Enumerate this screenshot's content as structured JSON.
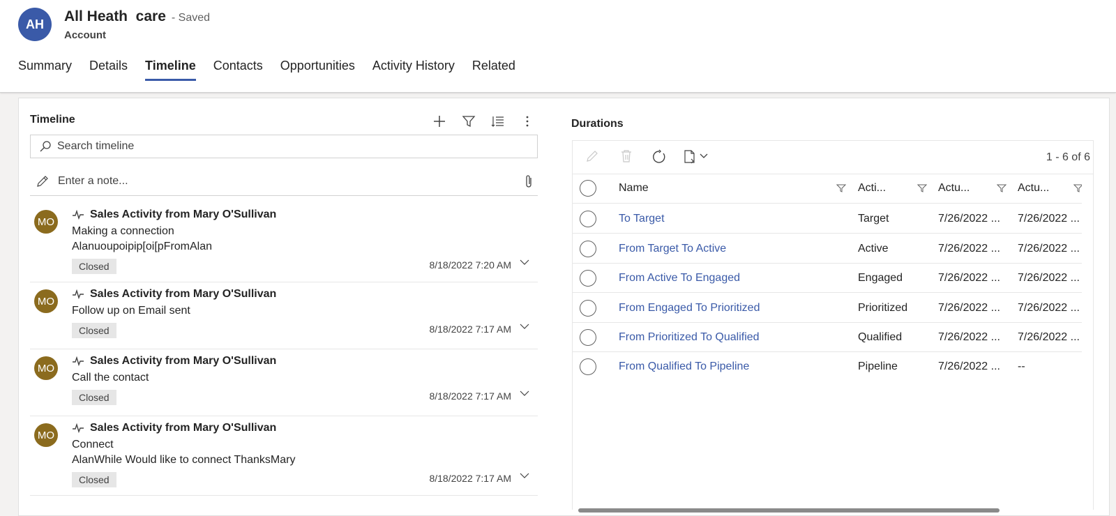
{
  "header": {
    "avatar_initials": "AH",
    "title": "All Heath  care",
    "saved_status": "- Saved",
    "record_type": "Account"
  },
  "tabs": [
    {
      "label": "Summary",
      "active": false
    },
    {
      "label": "Details",
      "active": false
    },
    {
      "label": "Timeline",
      "active": true
    },
    {
      "label": "Contacts",
      "active": false
    },
    {
      "label": "Opportunities",
      "active": false
    },
    {
      "label": "Activity History",
      "active": false
    },
    {
      "label": "Related",
      "active": false
    }
  ],
  "timeline": {
    "title": "Timeline",
    "actions": [
      "add-icon",
      "filter-icon",
      "sort-icon",
      "more-options-icon"
    ],
    "search_placeholder": "Search timeline",
    "note_placeholder": "Enter a note...",
    "items": [
      {
        "avatar": "MO",
        "header": "Sales Activity from Mary O'Sullivan",
        "lines": [
          "Making a connection",
          "Alanuoupoipip[oi[pFromAlan"
        ],
        "status": "Closed",
        "timestamp": "8/18/2022 7:20 AM"
      },
      {
        "avatar": "MO",
        "header": "Sales Activity from Mary O'Sullivan",
        "lines": [
          "Follow up on Email sent"
        ],
        "status": "Closed",
        "timestamp": "8/18/2022 7:17 AM"
      },
      {
        "avatar": "MO",
        "header": "Sales Activity from Mary O'Sullivan",
        "lines": [
          "Call the contact"
        ],
        "status": "Closed",
        "timestamp": "8/18/2022 7:17 AM"
      },
      {
        "avatar": "MO",
        "header": "Sales Activity from Mary O'Sullivan",
        "lines": [
          "Connect",
          "AlanWhile Would like to connect ThanksMary"
        ],
        "status": "Closed",
        "timestamp": "8/18/2022 7:17 AM"
      }
    ]
  },
  "durations": {
    "title": "Durations",
    "record_count": "1 - 6 of 6",
    "columns": [
      "Name",
      "Acti...",
      "Actu...",
      "Actu..."
    ],
    "rows": [
      {
        "name": "To Target",
        "activity": "Target",
        "actual_start": "7/26/2022 ...",
        "actual_end": "7/26/2022 ..."
      },
      {
        "name": "From Target To Active",
        "activity": "Active",
        "actual_start": "7/26/2022 ...",
        "actual_end": "7/26/2022 ..."
      },
      {
        "name": "From Active To Engaged",
        "activity": "Engaged",
        "actual_start": "7/26/2022 ...",
        "actual_end": "7/26/2022 ..."
      },
      {
        "name": "From Engaged To Prioritized",
        "activity": "Prioritized",
        "actual_start": "7/26/2022 ...",
        "actual_end": "7/26/2022 ..."
      },
      {
        "name": "From Prioritized To Qualified",
        "activity": "Qualified",
        "actual_start": "7/26/2022 ...",
        "actual_end": "7/26/2022 ..."
      },
      {
        "name": "From Qualified To Pipeline",
        "activity": "Pipeline",
        "actual_start": "7/26/2022 ...",
        "actual_end": "--"
      }
    ]
  },
  "colors": {
    "accent": "#3a5aa8",
    "avatar_mo": "#8b6b1e",
    "status_bg": "#e6e6e6"
  }
}
